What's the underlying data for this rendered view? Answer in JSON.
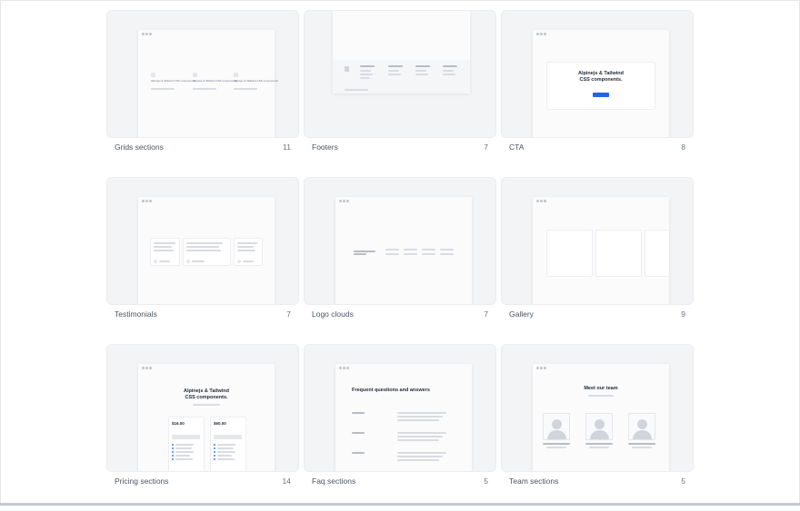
{
  "cards": [
    {
      "title": "Grids sections",
      "count": "11"
    },
    {
      "title": "Footers",
      "count": "7"
    },
    {
      "title": "CTA",
      "count": "8"
    },
    {
      "title": "Testimonials",
      "count": "7"
    },
    {
      "title": "Logo clouds",
      "count": "7"
    },
    {
      "title": "Gallery",
      "count": "9"
    },
    {
      "title": "Pricing sections",
      "count": "14"
    },
    {
      "title": "Faq sections",
      "count": "5"
    },
    {
      "title": "Team sections",
      "count": "5"
    }
  ],
  "previews": {
    "cta_heading_line1": "Alpinejs & Tailwind",
    "cta_heading_line2": "CSS components.",
    "pricing_heading_line1": "Alpinejs & Tailwind",
    "pricing_heading_line2": "CSS components.",
    "pricing_price_1": "$16.00",
    "pricing_price_2": "$60.00",
    "faq_heading": "Frequent questions and answers",
    "team_heading": "Meet our team",
    "grids_item_text": "Alpinejs & Tailwind CSS components"
  },
  "colors": {
    "accent": "#2563eb",
    "thumb_bg": "#f3f4f6"
  }
}
